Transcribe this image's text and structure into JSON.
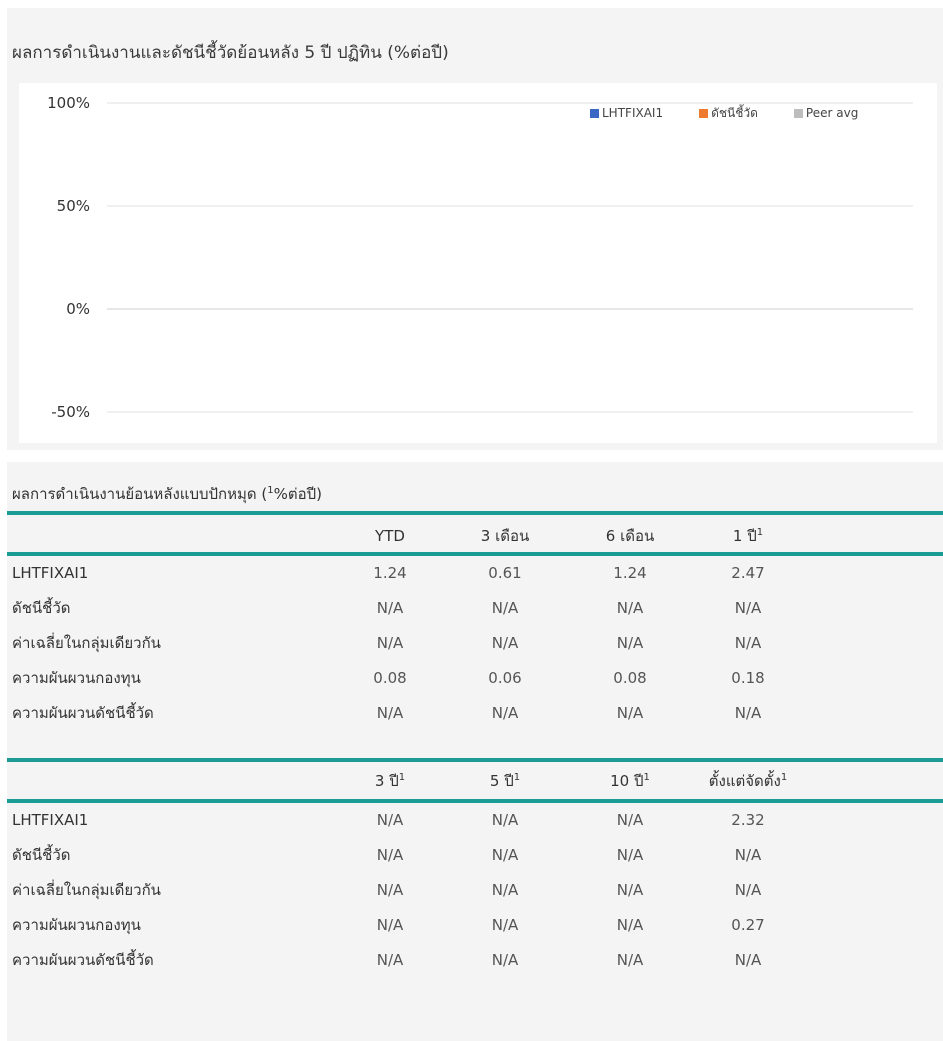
{
  "chart": {
    "title": "ผลการดำเนินงานและดัชนีชี้วัดย้อนหลัง 5 ปี ปฏิทิน (%ต่อปี)"
  },
  "chart_data": {
    "type": "bar",
    "title": "ผลการดำเนินงานและดัชนีชี้วัดย้อนหลัง 5 ปี ปฏิทิน (%ต่อปี)",
    "categories": [],
    "series": [
      {
        "name": "LHTFIXAI1",
        "color": "#3a66c4",
        "values": []
      },
      {
        "name": "ดัชนีชี้วัด",
        "color": "#ee7a30",
        "values": []
      },
      {
        "name": "Peer avg",
        "color": "#bdbdbd",
        "values": []
      }
    ],
    "yticks": [
      {
        "value": 100,
        "label": "100%"
      },
      {
        "value": 50,
        "label": "50%"
      },
      {
        "value": 0,
        "label": "0%"
      },
      {
        "value": -50,
        "label": "-50%"
      }
    ],
    "ylim": [
      -50,
      100
    ],
    "xlabel": "",
    "ylabel": "",
    "grid": true,
    "legend_position": "top-right"
  },
  "table": {
    "title": "ผลการดำเนินงานย้อนหลังแบบปักหมุด (",
    "title_sup": "1",
    "title_suffix": "%ต่อปี)",
    "block1": {
      "headers": [
        {
          "text": "YTD",
          "sup": ""
        },
        {
          "text": "3 เดือน",
          "sup": ""
        },
        {
          "text": "6 เดือน",
          "sup": ""
        },
        {
          "text": "1 ปี",
          "sup": "1"
        }
      ],
      "rows": [
        {
          "label": "LHTFIXAI1",
          "values": [
            "1.24",
            "0.61",
            "1.24",
            "2.47"
          ]
        },
        {
          "label": "ดัชนีชี้วัด",
          "values": [
            "N/A",
            "N/A",
            "N/A",
            "N/A"
          ]
        },
        {
          "label": "ค่าเฉลี่ยในกลุ่มเดียวกัน",
          "values": [
            "N/A",
            "N/A",
            "N/A",
            "N/A"
          ]
        },
        {
          "label": "ความผันผวนกองทุน",
          "values": [
            "0.08",
            "0.06",
            "0.08",
            "0.18"
          ]
        },
        {
          "label": "ความผันผวนดัชนีชี้วัด",
          "values": [
            "N/A",
            "N/A",
            "N/A",
            "N/A"
          ]
        }
      ]
    },
    "block2": {
      "headers": [
        {
          "text": "3 ปี",
          "sup": "1"
        },
        {
          "text": "5 ปี",
          "sup": "1"
        },
        {
          "text": "10 ปี",
          "sup": "1"
        },
        {
          "text": "ตั้งแต่จัดตั้ง",
          "sup": "1"
        }
      ],
      "rows": [
        {
          "label": "LHTFIXAI1",
          "values": [
            "N/A",
            "N/A",
            "N/A",
            "2.32"
          ]
        },
        {
          "label": "ดัชนีชี้วัด",
          "values": [
            "N/A",
            "N/A",
            "N/A",
            "N/A"
          ]
        },
        {
          "label": "ค่าเฉลี่ยในกลุ่มเดียวกัน",
          "values": [
            "N/A",
            "N/A",
            "N/A",
            "N/A"
          ]
        },
        {
          "label": "ความผันผวนกองทุน",
          "values": [
            "N/A",
            "N/A",
            "N/A",
            "0.27"
          ]
        },
        {
          "label": "ความผันผวนดัชนีชี้วัด",
          "values": [
            "N/A",
            "N/A",
            "N/A",
            "N/A"
          ]
        }
      ]
    }
  }
}
